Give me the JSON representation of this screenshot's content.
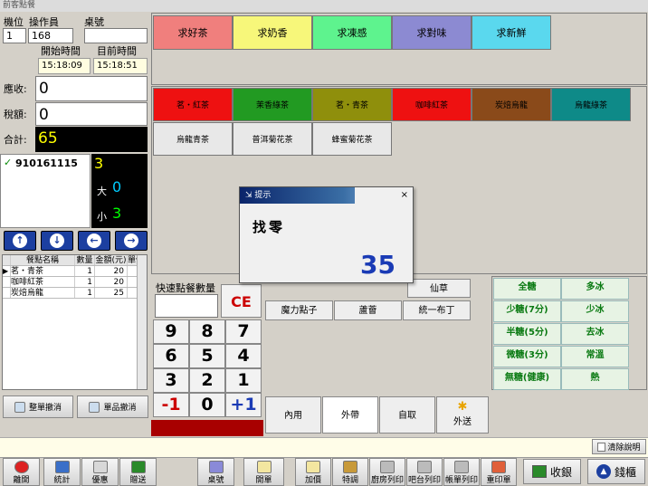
{
  "window": {
    "title": "前客點餐"
  },
  "header": {
    "machine_label": "機位",
    "operator_label": "操作員",
    "table_label": "桌號",
    "machine_value": "1",
    "operator_value": "168",
    "table_value": "",
    "start_time_label": "開始時間",
    "current_time_label": "目前時間",
    "start_time": "15:18:09",
    "current_time": "15:18:51"
  },
  "totals": {
    "receivable_label": "應收:",
    "receivable": "0",
    "tax_label": "稅額:",
    "tax": "0",
    "total_label": "合計:",
    "total": "65"
  },
  "order": {
    "ticket_id": "910161115",
    "count": "3",
    "large_label": "大",
    "large": "0",
    "small_label": "小",
    "small": "3"
  },
  "nav_icons": [
    "arrow-up",
    "arrow-down",
    "arrow-left",
    "arrow-right"
  ],
  "order_list": {
    "columns": [
      "餐點名稱",
      "數量",
      "金額(元)",
      "單價"
    ],
    "rows": [
      [
        "茗・青茶",
        "1",
        "20",
        ""
      ],
      [
        "咖啡紅茶",
        "1",
        "20",
        ""
      ],
      [
        "炭焙烏龍",
        "1",
        "25",
        ""
      ]
    ]
  },
  "actions": {
    "cancel_all": "整單撤消",
    "cancel_item": "單品撤消"
  },
  "categories": [
    {
      "label": "求好茶",
      "color": "#f07f7d"
    },
    {
      "label": "求奶香",
      "color": "#f7f77a"
    },
    {
      "label": "求凍感",
      "color": "#5ef38e"
    },
    {
      "label": "求對味",
      "color": "#8c8ad2"
    },
    {
      "label": "求新鮮",
      "color": "#5ad8ee"
    }
  ],
  "teas_row1": [
    {
      "label": "茗・紅茶",
      "color": "#ee1111"
    },
    {
      "label": "茉香綠茶",
      "color": "#229a22"
    },
    {
      "label": "茗・青茶",
      "color": "#8f8f0c"
    },
    {
      "label": "咖啡紅茶",
      "color": "#ee1111"
    },
    {
      "label": "炭焙烏龍",
      "color": "#8a4a1a"
    },
    {
      "label": "烏龍綠茶",
      "color": "#0e8a88"
    }
  ],
  "teas_row2": [
    "烏龍青茶",
    "普洱菊花茶",
    "蜂蜜菊花茶"
  ],
  "quick": {
    "label": "快速點餐數量",
    "ce": "CE",
    "keys": [
      "9",
      "8",
      "7",
      "6",
      "5",
      "4",
      "3",
      "2",
      "1",
      "-1",
      "0",
      "+1"
    ]
  },
  "toppings": {
    "row1": [
      "仙草"
    ],
    "row2": [
      "魔力點子",
      "蘆薈",
      "統一布丁"
    ]
  },
  "sugar": [
    "全糖",
    "多冰",
    "少糖(7分)",
    "少冰",
    "半糖(5分)",
    "去冰",
    "微糖(3分)",
    "常溫",
    "無糖(健康)",
    "熱"
  ],
  "modes": [
    "內用",
    "外帶",
    "自取",
    "外送"
  ],
  "dialog": {
    "title": "提示",
    "message": "找零",
    "amount": "35"
  },
  "clear_note": "清除說明",
  "toolbar": {
    "left": [
      "離開",
      "統計",
      "優惠",
      "贈送"
    ],
    "mid": [
      "桌號",
      "開單",
      "加價",
      "特調",
      "廚房列印",
      "吧台列印",
      "帳單列印",
      "重印單"
    ],
    "checkout": "收銀",
    "drawer": "錢櫃"
  },
  "colors": {
    "accent": "#1c3fa0",
    "total_bg": "#000000",
    "total_fg": "#ffff00",
    "amount": "#1a3bb5",
    "ce": "#cc0000",
    "plus": "#1a3bb5"
  }
}
